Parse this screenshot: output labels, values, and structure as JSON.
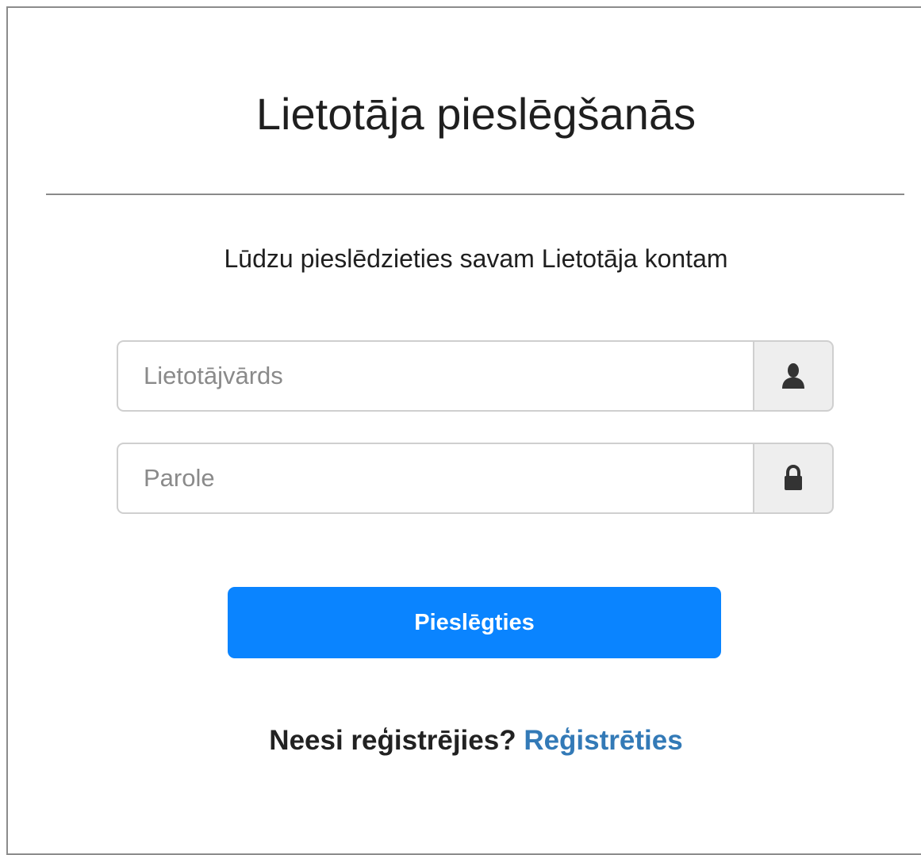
{
  "login": {
    "title": "Lietotāja pieslēgšanās",
    "subtitle": "Lūdzu pieslēdzieties savam Lietotāja kontam",
    "username": {
      "value": "",
      "placeholder": "Lietotājvārds",
      "icon": "user-icon"
    },
    "password": {
      "value": "",
      "placeholder": "Parole",
      "icon": "lock-icon"
    },
    "submit_label": "Pieslēgties",
    "register_prompt": "Neesi reģistrējies?",
    "register_link": "Reģistrēties"
  },
  "colors": {
    "button": "#0a84ff",
    "link": "#337ab7",
    "addon_bg": "#eeeeee",
    "border": "#cfcfcf"
  }
}
